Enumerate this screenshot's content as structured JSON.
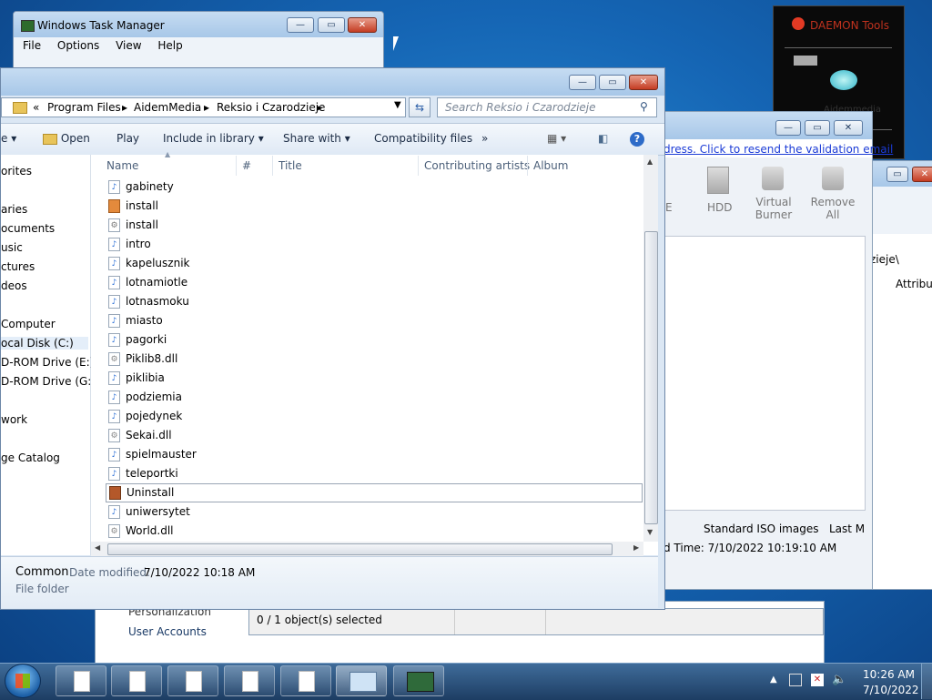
{
  "task_manager": {
    "title": "Windows Task Manager",
    "menu": [
      "File",
      "Options",
      "View",
      "Help"
    ]
  },
  "daemon": {
    "title": "DAEMON Tools",
    "subtitle": "Aidemmedia"
  },
  "daemon_main": {
    "link_text": "dress. Click to resend the validation email",
    "toolbar": [
      {
        "label": "E"
      },
      {
        "label": "HDD"
      },
      {
        "label": "Virtual\nBurner"
      },
      {
        "label": "Remove\nAll"
      }
    ],
    "status_left": "Standard ISO images",
    "status_right": "Last M",
    "time_text": "d Time: 7/10/2022 10:19:10 AM"
  },
  "right_window": {
    "path_fragment": "zieje\\",
    "column": "Attribut"
  },
  "background_window": {
    "items": [
      "Personalization",
      "User Accounts"
    ],
    "status": "0 / 1 object(s) selected"
  },
  "explorer": {
    "breadcrumb": [
      "«",
      "Program Files",
      "AidemMedia",
      "Reksio i Czarodzieje"
    ],
    "search_placeholder": "Search Reksio i Czarodzieje",
    "toolbar": {
      "organize": "e",
      "open": "Open",
      "play": "Play",
      "include": "Include in library",
      "share": "Share with",
      "compat": "Compatibility files",
      "more": "»"
    },
    "columns": [
      "Name",
      "#",
      "Title",
      "Contributing artists",
      "Album"
    ],
    "nav": [
      "orites",
      "aries",
      "ocuments",
      "usic",
      "ctures",
      "deos",
      "Computer",
      "ocal Disk (C:)",
      "D-ROM Drive (E:) A",
      "D-ROM Drive (G:) A",
      "work",
      "ge Catalog"
    ],
    "files": [
      {
        "name": "gabinety",
        "icon": "audio-file-icon"
      },
      {
        "name": "install",
        "icon": "install-app-icon"
      },
      {
        "name": "install",
        "icon": "settings-file-icon"
      },
      {
        "name": "intro",
        "icon": "audio-file-icon"
      },
      {
        "name": "kapelusznik",
        "icon": "audio-file-icon"
      },
      {
        "name": "lotnamiotle",
        "icon": "audio-file-icon"
      },
      {
        "name": "lotnasmoku",
        "icon": "audio-file-icon"
      },
      {
        "name": "miasto",
        "icon": "audio-file-icon"
      },
      {
        "name": "pagorki",
        "icon": "audio-file-icon"
      },
      {
        "name": "Piklib8.dll",
        "icon": "dll-file-icon"
      },
      {
        "name": "piklibia",
        "icon": "audio-file-icon"
      },
      {
        "name": "podziemia",
        "icon": "audio-file-icon"
      },
      {
        "name": "pojedynek",
        "icon": "audio-file-icon"
      },
      {
        "name": "Sekai.dll",
        "icon": "dll-file-icon"
      },
      {
        "name": "spielmauster",
        "icon": "audio-file-icon"
      },
      {
        "name": "teleportki",
        "icon": "audio-file-icon"
      },
      {
        "name": "Uninstall",
        "icon": "uninstall-app-icon"
      },
      {
        "name": "uniwersytet",
        "icon": "audio-file-icon"
      },
      {
        "name": "World.dll",
        "icon": "dll-file-icon"
      }
    ],
    "details": {
      "name": "Common",
      "modified_label": "Date modified:",
      "modified_value": "7/10/2022 10:18 AM",
      "type": "File folder"
    }
  },
  "taskbar": {
    "time": "10:26 AM",
    "date": "7/10/2022"
  }
}
